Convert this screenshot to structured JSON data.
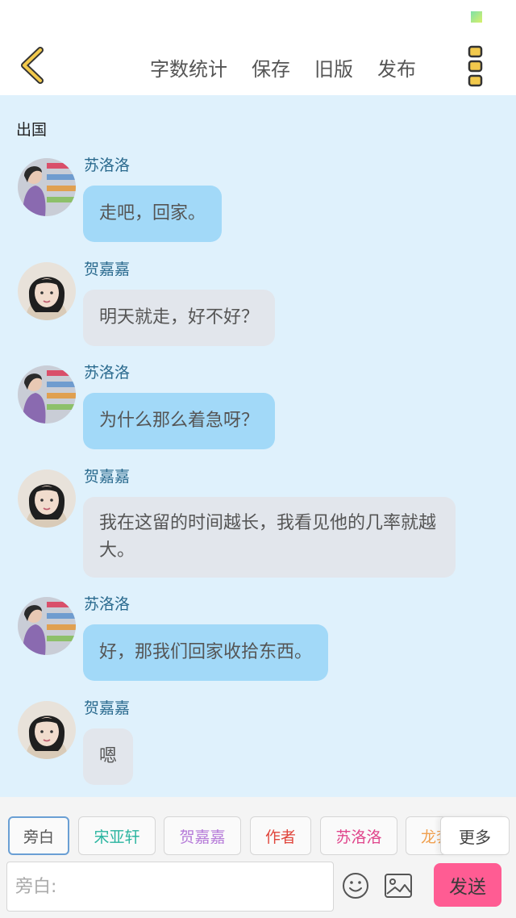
{
  "header": {
    "back_icon": "chevron-left-icon",
    "actions": [
      "字数统计",
      "保存",
      "旧版",
      "发布"
    ],
    "more_icon": "more-vertical-icon",
    "accent_color": "#f2c94c"
  },
  "chat": {
    "title": "出国",
    "messages": [
      {
        "sender": "苏洛洛",
        "text": "走吧，回家。",
        "style": "blue"
      },
      {
        "sender": "贺嘉嘉",
        "text": "明天就走，好不好？",
        "style": "gray"
      },
      {
        "sender": "苏洛洛",
        "text": "为什么那么着急呀？",
        "style": "blue"
      },
      {
        "sender": "贺嘉嘉",
        "text": "我在这留的时间越长，我看见他的几率就越大。",
        "style": "gray"
      },
      {
        "sender": "苏洛洛",
        "text": "好，那我们回家收拾东西。",
        "style": "blue"
      },
      {
        "sender": "贺嘉嘉",
        "text": "嗯",
        "style": "gray"
      }
    ]
  },
  "role_chips": [
    {
      "label": "旁白",
      "color": "#555555",
      "active": true
    },
    {
      "label": "宋亚轩",
      "color": "#2bb5a0"
    },
    {
      "label": "贺嘉嘉",
      "color": "#b57ad8"
    },
    {
      "label": "作者",
      "color": "#e0463c"
    },
    {
      "label": "苏洛洛",
      "color": "#e0468c"
    },
    {
      "label": "龙套",
      "color": "#f0a050"
    }
  ],
  "more_label": "更多",
  "input": {
    "placeholder": "旁白:"
  },
  "send_label": "发送",
  "colors": {
    "chat_bg": "#dff1fc",
    "bubble_blue": "#a2d9f8",
    "bubble_gray": "#e2e6ec",
    "send": "#ff5c93"
  }
}
